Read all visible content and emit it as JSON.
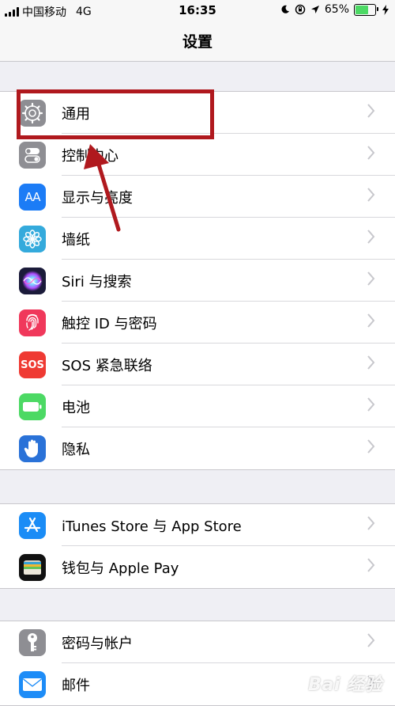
{
  "status_bar": {
    "carrier": "中国移动",
    "network": "4G",
    "time": "16:35",
    "battery_percent": "65%",
    "battery_level": 0.65,
    "icons": [
      "moon-icon",
      "rotation-lock-icon",
      "location-icon",
      "battery-icon",
      "charging-icon"
    ]
  },
  "nav": {
    "title": "设置"
  },
  "groups": [
    {
      "rows": [
        {
          "label": "通用",
          "icon": "gear-icon",
          "color": "#8e8e93"
        },
        {
          "label": "控制中心",
          "icon": "toggles-icon",
          "color": "#8e8e93"
        },
        {
          "label": "显示与亮度",
          "icon": "text-size-icon",
          "color": "#1c7cf6",
          "icon_text": "AA"
        },
        {
          "label": "墙纸",
          "icon": "flower-icon",
          "color": "#34aadc"
        },
        {
          "label": "Siri 与搜索",
          "icon": "siri-icon",
          "color": "#1b1b3a"
        },
        {
          "label": "触控 ID 与密码",
          "icon": "fingerprint-icon",
          "color": "#f0385b"
        },
        {
          "label": "SOS 紧急联络",
          "icon": "sos-icon",
          "color": "#ef3a33",
          "icon_text": "SOS"
        },
        {
          "label": "电池",
          "icon": "battery-icon",
          "color": "#4cd964"
        },
        {
          "label": "隐私",
          "icon": "hand-icon",
          "color": "#2a72d8"
        }
      ]
    },
    {
      "rows": [
        {
          "label": "iTunes Store 与 App Store",
          "icon": "app-store-icon",
          "color": "#1a8cf6"
        },
        {
          "label": "钱包与 Apple Pay",
          "icon": "wallet-icon",
          "color": "#111111"
        }
      ]
    },
    {
      "rows": [
        {
          "label": "密码与帐户",
          "icon": "key-icon",
          "color": "#8e8e93"
        },
        {
          "label": "邮件",
          "icon": "mail-icon",
          "color": "#1d8cf7"
        }
      ]
    }
  ],
  "annotation": {
    "color": "#b0191e"
  },
  "watermark": "Bai 经验"
}
